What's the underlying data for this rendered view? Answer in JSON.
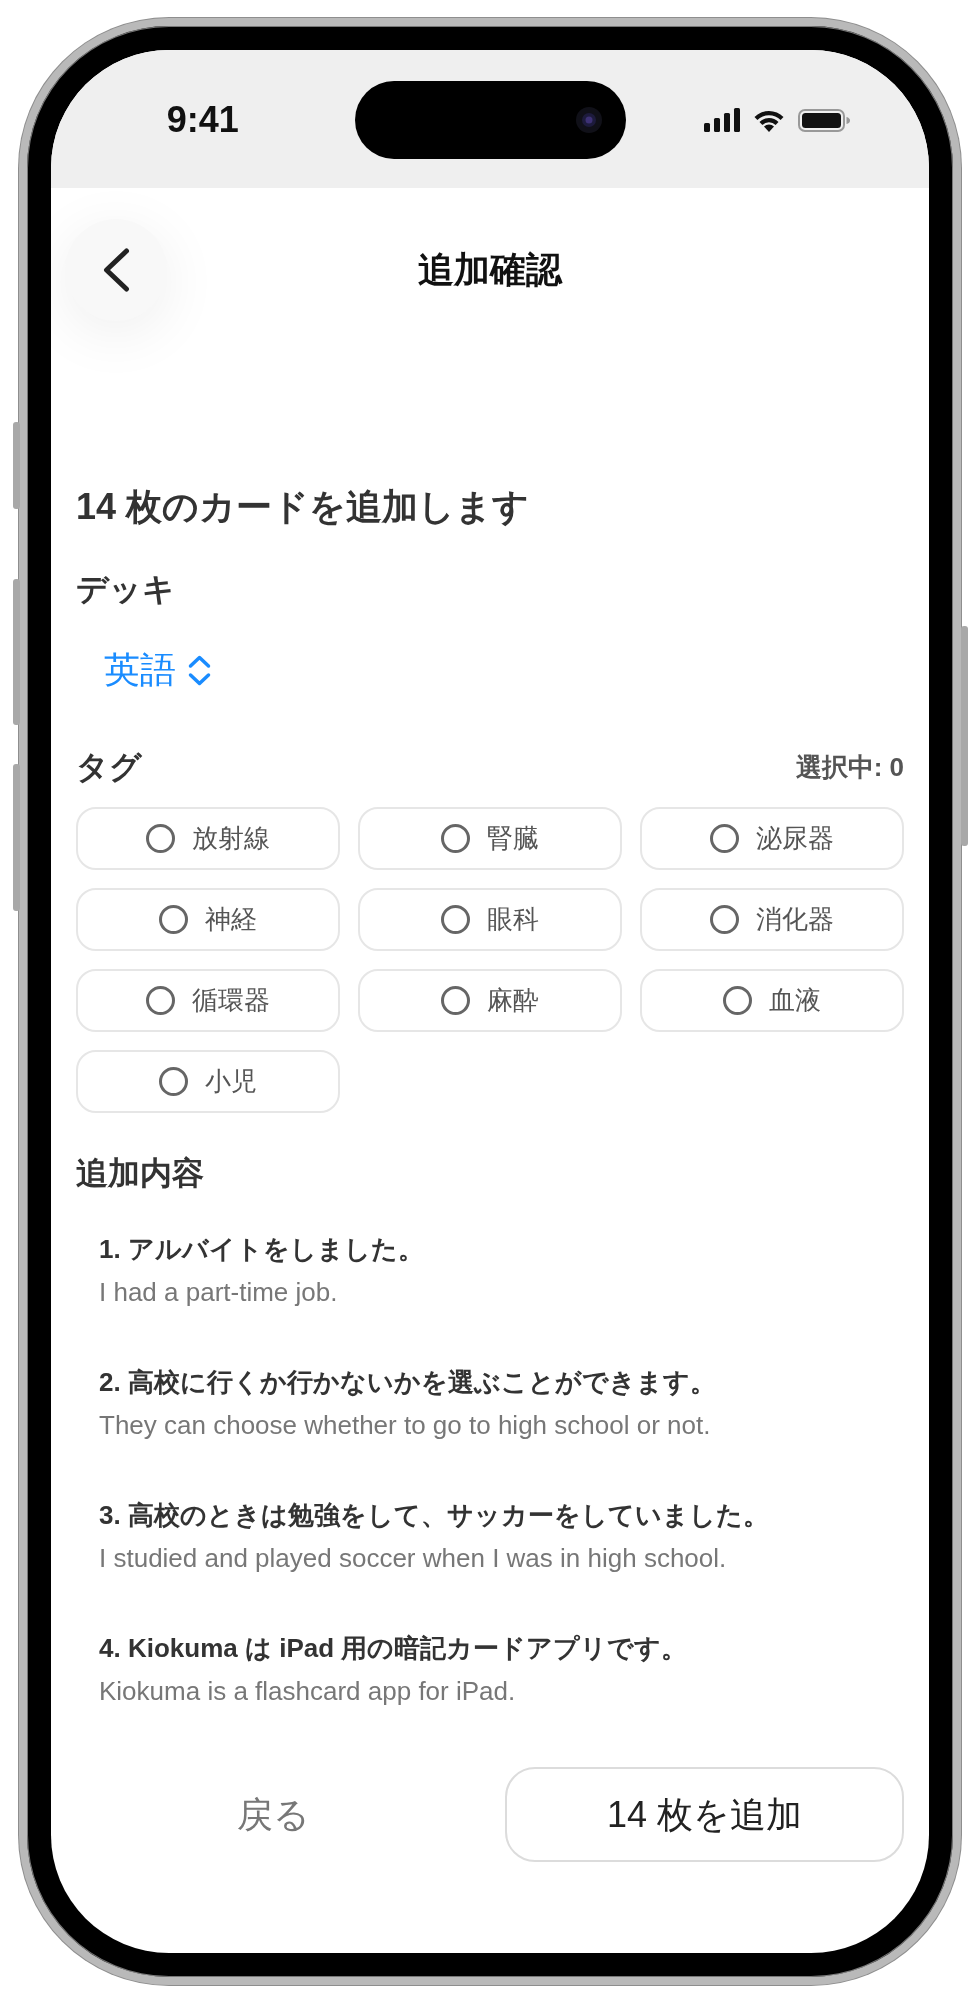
{
  "status_bar": {
    "time": "9:41"
  },
  "nav_bar": {
    "title": "追加確認"
  },
  "summary": "14 枚のカードを追加します",
  "deck": {
    "label": "デッキ",
    "value": "英語"
  },
  "tags": {
    "label": "タグ",
    "selected_count": "選択中: 0",
    "items": [
      {
        "label": "放射線",
        "selected": false
      },
      {
        "label": "腎臓",
        "selected": false
      },
      {
        "label": "泌尿器",
        "selected": false
      },
      {
        "label": "神経",
        "selected": false
      },
      {
        "label": "眼科",
        "selected": false
      },
      {
        "label": "消化器",
        "selected": false
      },
      {
        "label": "循環器",
        "selected": false
      },
      {
        "label": "麻酔",
        "selected": false
      },
      {
        "label": "血液",
        "selected": false
      },
      {
        "label": "小児",
        "selected": false
      }
    ]
  },
  "contents": {
    "label": "追加内容",
    "items": [
      {
        "sentence": "1. アルバイトをしました。",
        "translation": "I had a part-time job."
      },
      {
        "sentence": "2. 高校に行くか行かないかを選ぶことができます。",
        "translation": "They can choose whether to go to high school or not."
      },
      {
        "sentence": "3. 高校のときは勉強をして、サッカーをしていました。",
        "translation": "I studied and played soccer when I was in high school."
      },
      {
        "sentence": "4. Kiokuma は iPad 用の暗記カードアプリです。",
        "translation": "Kiokuma is a flashcard app for iPad."
      }
    ]
  },
  "buttons": [
    {
      "label": "戻る",
      "kind": "plain"
    },
    {
      "label": "14 枚を追加",
      "kind": "bordered"
    }
  ]
}
